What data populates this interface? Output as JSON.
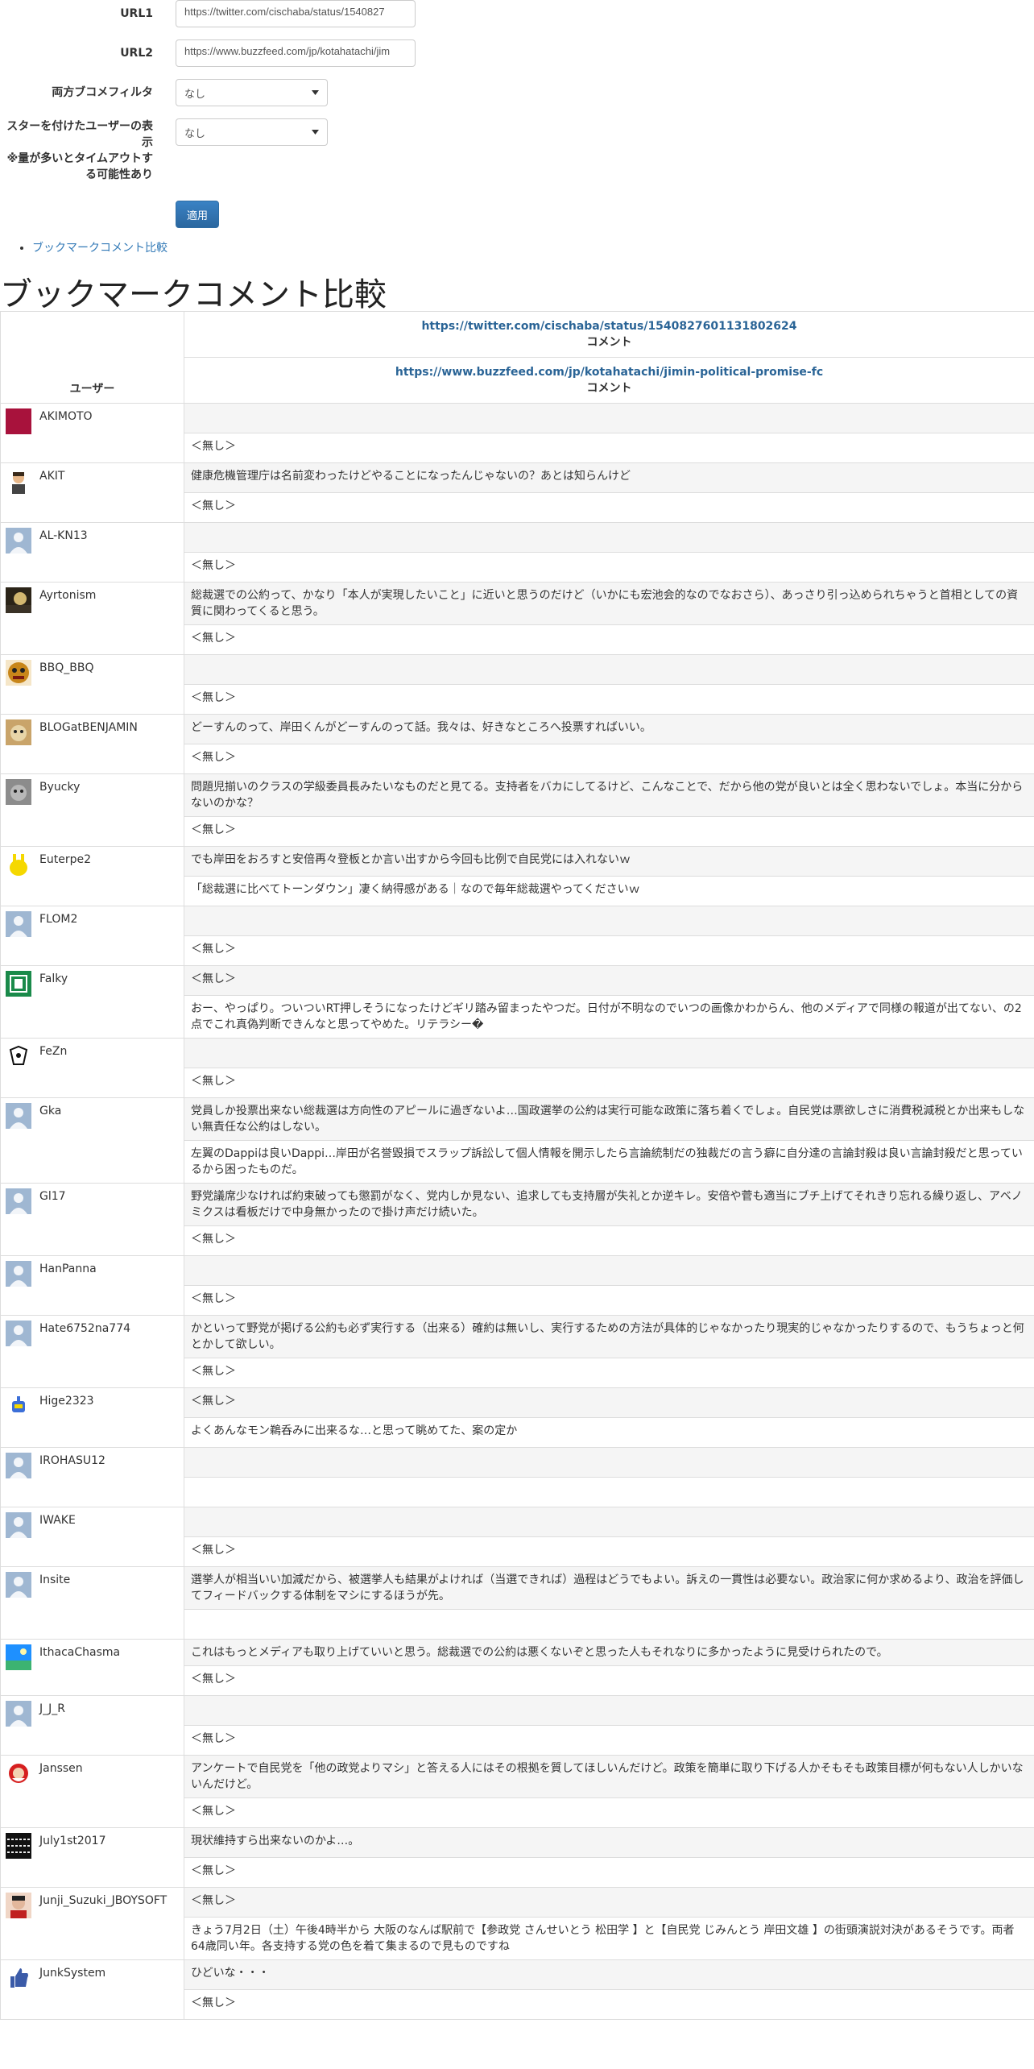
{
  "form": {
    "url1_label": "URL1",
    "url1_value": "https://twitter.com/cischaba/status/1540827",
    "url2_label": "URL2",
    "url2_value": "https://www.buzzfeed.com/jp/kotahatachi/jim",
    "filter_label": "両方ブコメフィルタ",
    "filter_value": "なし",
    "star_label_1": "スターを付けたユーザーの表",
    "star_label_2": "示",
    "star_label_3": "※量が多いとタイムアウトす",
    "star_label_4": "る可能性あり",
    "star_value": "なし",
    "apply_label": "適用"
  },
  "breadcrumb": {
    "link": "ブックマークコメント比較"
  },
  "page_title": "ブックマークコメント比較",
  "table": {
    "user_header": "ユーザー",
    "url1": "https://twitter.com/cischaba/status/1540827601131802624",
    "url2": "https://www.buzzfeed.com/jp/kotahatachi/jimin-political-promise-fc",
    "comment_header": "コメント",
    "rows": [
      {
        "user": "AKIMOTO",
        "c1": "",
        "c2": "＜無し＞",
        "avatar": "crimson"
      },
      {
        "user": "AKIT",
        "c1": "健康危機管理庁は名前変わったけどやることになったんじゃないの？あとは知らんけど",
        "c2": "＜無し＞",
        "avatar": "face"
      },
      {
        "user": "AL-KN13",
        "c1": "",
        "c2": "＜無し＞",
        "avatar": "default"
      },
      {
        "user": "Ayrtonism",
        "c1": "総裁選での公約って、かなり「本人が実現したいこと」に近いと思うのだけど（いかにも宏池会的なのでなおさら）、あっさり引っ込められちゃうと首相としての資質に関わってくると思う。",
        "c2": "＜無し＞",
        "avatar": "dark"
      },
      {
        "user": "BBQ_BBQ",
        "c1": "",
        "c2": "＜無し＞",
        "avatar": "mask"
      },
      {
        "user": "BLOGatBENJAMIN",
        "c1": "どーすんのって、岸田くんがどーすんのって話。我々は、好きなところへ投票すればいい。",
        "c2": "＜無し＞",
        "avatar": "dog"
      },
      {
        "user": "Byucky",
        "c1": "問題児揃いのクラスの学級委員長みたいなものだと見てる。支持者をバカにしてるけど、こんなことで、だから他の党が良いとは全く思わないでしょ。本当に分からないのかな？",
        "c2": "＜無し＞",
        "avatar": "cat"
      },
      {
        "user": "Euterpe2",
        "c1": "でも岸田をおろすと安倍再々登板とか言い出すから今回も比例で自民党には入れないｗ",
        "c2": "「総裁選に比べてトーンダウン」凄く納得感がある｜なので毎年総裁選やってくださいｗ",
        "avatar": "yellow"
      },
      {
        "user": "FLOM2",
        "c1": "",
        "c2": "＜無し＞",
        "avatar": "default"
      },
      {
        "user": "Falky",
        "c1": "＜無し＞",
        "c2": "おー、やっぱり。ついついRT押しそうになったけどギリ踏み留まったやつだ。日付が不明なのでいつの画像かわからん、他のメディアで同様の報道が出てない、の2点でこれ真偽判断できんなと思ってやめた。リテラシー�",
        "avatar": "green"
      },
      {
        "user": "FeZn",
        "c1": "",
        "c2": "＜無し＞",
        "avatar": "sketch"
      },
      {
        "user": "Gka",
        "c1": "党員しか投票出来ない総裁選は方向性のアピールに過ぎないよ…国政選挙の公約は実行可能な政策に落ち着くでしょ。自民党は票欲しさに消費税減税とか出来もしない無責任な公約はしない。",
        "c2": "左翼のDappiは良いDappi…岸田が名誉毀損でスラップ訴訟して個人情報を開示したら言論統制だの独裁だの言う癖に自分達の言論封殺は良い言論封殺だと思っているから困ったものだ。",
        "avatar": "default"
      },
      {
        "user": "Gl17",
        "c1": "野党議席少なければ約束破っても懲罰がなく、党内しか見ない、追求しても支持層が失礼とか逆キレ。安倍や菅も適当にブチ上げてそれきり忘れる繰り返し、アベノミクスは看板だけで中身無かったので掛け声だけ続いた。",
        "c2": "＜無し＞",
        "avatar": "default"
      },
      {
        "user": "HanPanna",
        "c1": "",
        "c2": "＜無し＞",
        "avatar": "default"
      },
      {
        "user": "Hate6752na774",
        "c1": "かといって野党が掲げる公約も必ず実行する（出来る）確約は無いし、実行するための方法が具体的じゃなかったり現実的じゃなかったりするので、もうちょっと何とかして欲しい。",
        "c2": "＜無し＞",
        "avatar": "default"
      },
      {
        "user": "Hige2323",
        "c1": "＜無し＞",
        "c2": "よくあんなモン鵜呑みに出来るな…と思って眺めてた、案の定か",
        "avatar": "robot"
      },
      {
        "user": "IROHASU12",
        "c1": "",
        "c2": "",
        "avatar": "default"
      },
      {
        "user": "IWAKE",
        "c1": "",
        "c2": "＜無し＞",
        "avatar": "default"
      },
      {
        "user": "Insite",
        "c1": "選挙人が相当いい加減だから、被選挙人も結果がよければ（当選できれば）過程はどうでもよい。訴えの一貫性は必要ない。政治家に何か求めるより、政治を評価してフィードバックする体制をマシにするほうが先。",
        "c2": "",
        "avatar": "default"
      },
      {
        "user": "IthacaChasma",
        "c1": "これはもっとメディアも取り上げていいと思う。総裁選での公約は悪くないぞと思った人もそれなりに多かったように見受けられたので。",
        "c2": "＜無し＞",
        "avatar": "beach"
      },
      {
        "user": "J_J_R",
        "c1": "",
        "c2": "＜無し＞",
        "avatar": "default"
      },
      {
        "user": "Janssen",
        "c1": "アンケートで自民党を「他の政党よりマシ」と答える人にはその根拠を質してほしいんだけど。政策を簡単に取り下げる人かそもそも政策目標が何もない人しかいないんだけど。",
        "c2": "＜無し＞",
        "avatar": "santa"
      },
      {
        "user": "July1st2017",
        "c1": "現状維持すら出来ないのかよ…。",
        "c2": "＜無し＞",
        "avatar": "pattern"
      },
      {
        "user": "Junji_Suzuki_JBOYSOFT",
        "c1": "＜無し＞",
        "c2": "きょう7月2日（土）午後4時半から 大阪のなんば駅前で【参政党 さんせいとう 松田学 】と【自民党 じみんとう 岸田文雄 】の街頭演説対決があるそうです。両者64歳同い年。各支持する党の色を着て集まるので見ものですね",
        "avatar": "person"
      },
      {
        "user": "JunkSystem",
        "c1": "ひどいな・・・",
        "c2": "＜無し＞",
        "avatar": "thumb"
      }
    ]
  }
}
